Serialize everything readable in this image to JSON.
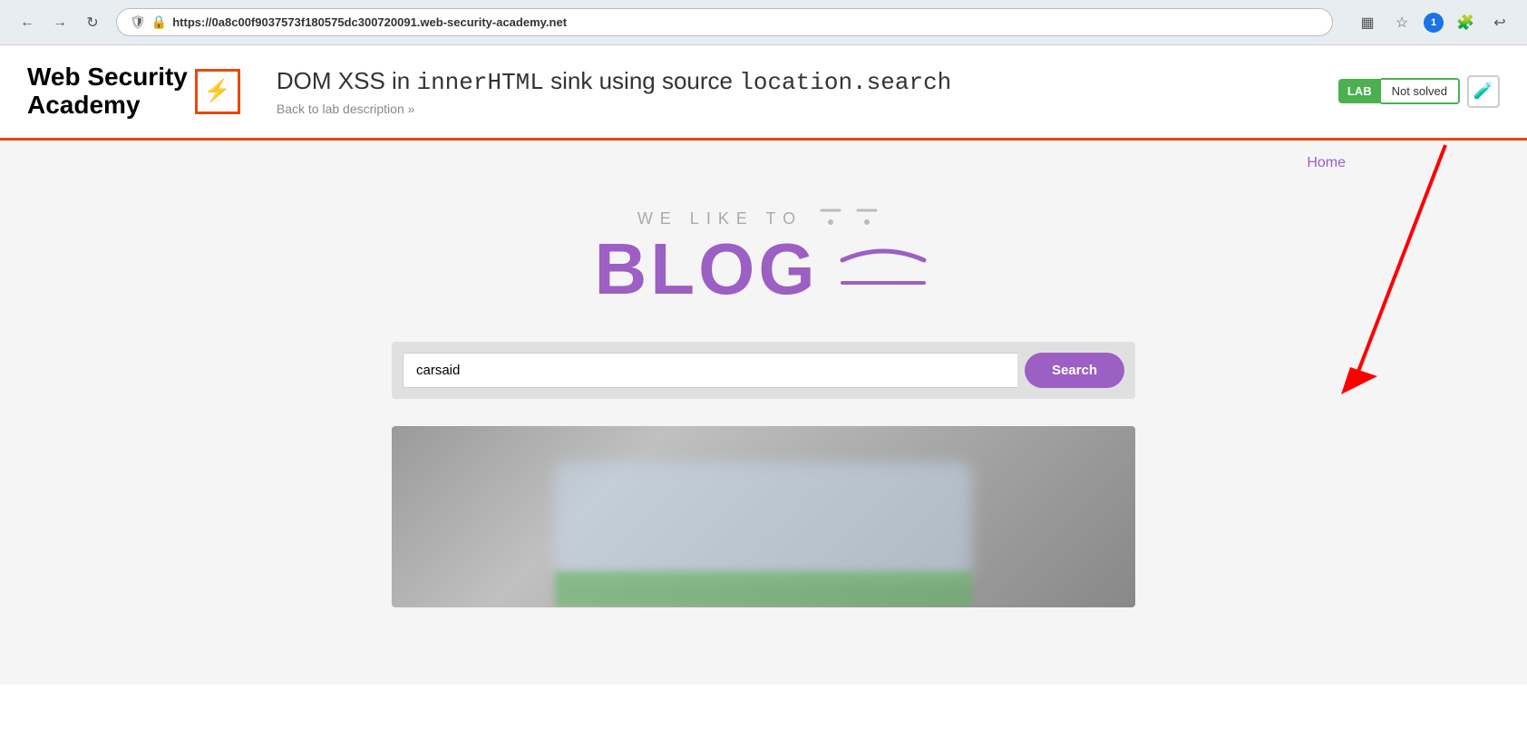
{
  "browser": {
    "back_label": "←",
    "forward_label": "→",
    "reload_label": "↻",
    "url_prefix": "https://0a8c00f9037573f180575dc300720091.",
    "url_domain": "web-security-academy.net",
    "qr_icon": "▦",
    "star_icon": "☆",
    "notification_count": "1",
    "extension_icon": "🧩",
    "account_icon": "↩"
  },
  "header": {
    "logo_line1": "Web Security",
    "logo_line2": "Academy",
    "logo_symbol": "⚡",
    "lab_title_prefix": "DOM XSS in ",
    "lab_title_sink": "innerHTML",
    "lab_title_middle": " sink using source ",
    "lab_title_source": "location.",
    "lab_title_suffix": "search",
    "back_link_label": "Back to lab description »",
    "lab_badge": "LAB",
    "not_solved_label": "Not solved",
    "flask_icon": "🧪"
  },
  "nav": {
    "home_label": "Home"
  },
  "blog": {
    "tagline_prefix": "WE LIKE TO",
    "main_word": "BLOG"
  },
  "search": {
    "input_value": "carsaid",
    "button_label": "Search"
  }
}
